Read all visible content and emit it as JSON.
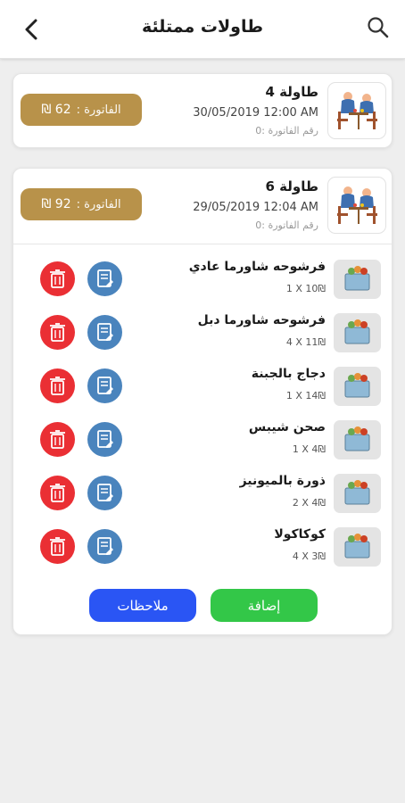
{
  "header": {
    "title": "طاولات ممتلئة"
  },
  "tables": [
    {
      "name": "طاولة 4",
      "datetime": "30/05/2019 12:00 AM",
      "invoice_line": "رقم الفاتورة :0",
      "bill_label": "الفاتورة :",
      "bill_value": "62 ₪"
    },
    {
      "name": "طاولة 6",
      "datetime": "29/05/2019 12:04 AM",
      "invoice_line": "رقم الفاتورة :0",
      "bill_label": "الفاتورة :",
      "bill_value": "92 ₪",
      "items": [
        {
          "name": "فرشوحه شاورما عادي",
          "qty": "1 X 10₪"
        },
        {
          "name": "فرشوحه شاورما دبل",
          "qty": "4 X 11₪"
        },
        {
          "name": "دجاج بالجبنة",
          "qty": "1 X 14₪"
        },
        {
          "name": "صحن شيبس",
          "qty": "1 X 4₪"
        },
        {
          "name": "ذورة بالميونيز",
          "qty": "2 X 4₪"
        },
        {
          "name": "كوكاكولا",
          "qty": "4 X 3₪"
        }
      ],
      "add_label": "إضافة",
      "notes_label": "ملاحظات"
    }
  ],
  "colors": {
    "bill": "#b8924a",
    "edit": "#4a84bd",
    "delete": "#ea2f34",
    "add": "#33c748",
    "notes": "#2a55f4"
  },
  "icons": {
    "back": "chevron-left-icon",
    "search": "search-icon",
    "table": "dining-table-icon",
    "food": "food-icon",
    "edit": "edit-icon",
    "delete": "trash-icon"
  }
}
